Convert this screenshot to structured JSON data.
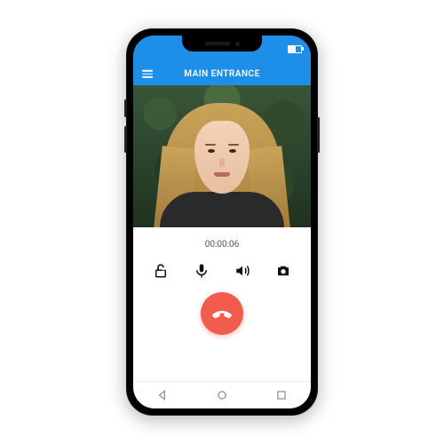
{
  "header": {
    "title": "MAIN ENTRANCE"
  },
  "call": {
    "timer": "00:00:06"
  },
  "icons": {
    "menu": "menu-icon",
    "battery": "battery-icon",
    "unlock": "unlock-icon",
    "mic": "microphone-icon",
    "speaker": "speaker-icon",
    "camera": "camera-icon",
    "hangup": "hangup-icon",
    "nav_back": "back-icon",
    "nav_home": "home-icon",
    "nav_recent": "recent-icon"
  },
  "colors": {
    "accent": "#1e8fe8",
    "hangup": "#f25c4d"
  }
}
